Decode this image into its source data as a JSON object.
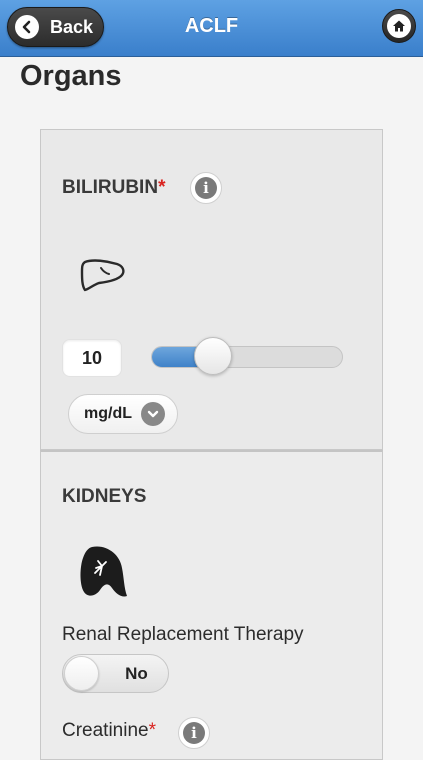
{
  "header": {
    "back_label": "Back",
    "title": "ACLF"
  },
  "page": {
    "title": "Organs"
  },
  "bilirubin": {
    "label": "BILIRUBIN",
    "required_mark": "*",
    "info_glyph": "i",
    "icon": "liver-icon",
    "value": "10",
    "slider_fraction": 0.2,
    "unit": "mg/dL"
  },
  "kidneys": {
    "label": "KIDNEYS",
    "icon": "kidney-icon",
    "rrt_label": "Renal Replacement Therapy",
    "rrt_value": "No",
    "creatinine_label": "Creatinine",
    "required_mark": "*",
    "info_glyph": "i"
  },
  "colors": {
    "header": "#4a8fd6",
    "required": "#d9231f",
    "slider_fill": "#4f8fd1"
  }
}
